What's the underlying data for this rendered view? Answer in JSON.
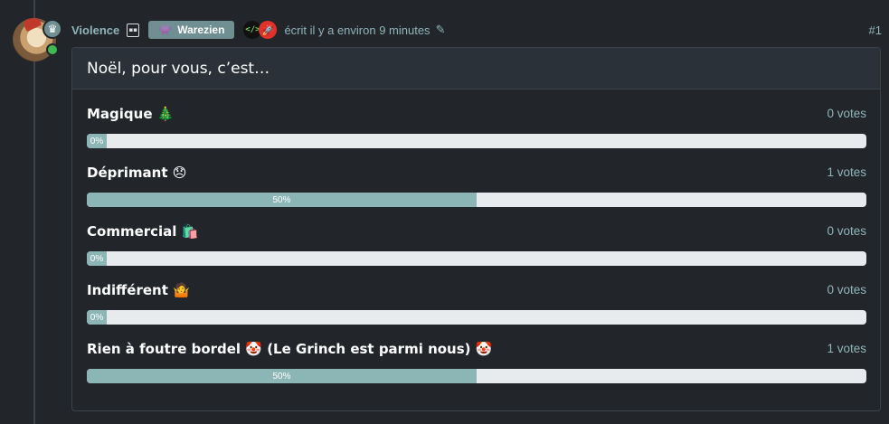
{
  "author": {
    "username": "Violence",
    "group_badge": "Warezien",
    "timestamp": "écrit il y a environ 9 minutes",
    "post_index": "#1"
  },
  "icons": {
    "crown": "crown-icon",
    "twitch": "twitch-icon",
    "group": "alien-icon",
    "code": "code-icon",
    "rocket": "rocket-icon",
    "edit": "edit-icon"
  },
  "colors": {
    "accent": "#8fb5b8",
    "badge_bg": "#6f8f93",
    "bar_fill": "#8cb6b5",
    "bar_track": "#e8ebed",
    "online": "#3fb950"
  },
  "poll": {
    "title": "Noël, pour vous, c’est…",
    "options": [
      {
        "label": "Magique 🎄",
        "votes": "0 votes",
        "percent_label": "0%",
        "fraction": 0
      },
      {
        "label": "Déprimant 😞",
        "votes": "1 votes",
        "percent_label": "50%",
        "fraction": 0.5
      },
      {
        "label": "Commercial 🛍️",
        "votes": "0 votes",
        "percent_label": "0%",
        "fraction": 0
      },
      {
        "label": "Indifférent 🤷",
        "votes": "0 votes",
        "percent_label": "0%",
        "fraction": 0
      },
      {
        "label": "Rien à foutre bordel 🤡 (Le Grinch est parmi nous) 🤡",
        "votes": "1 votes",
        "percent_label": "50%",
        "fraction": 0.5
      }
    ]
  }
}
